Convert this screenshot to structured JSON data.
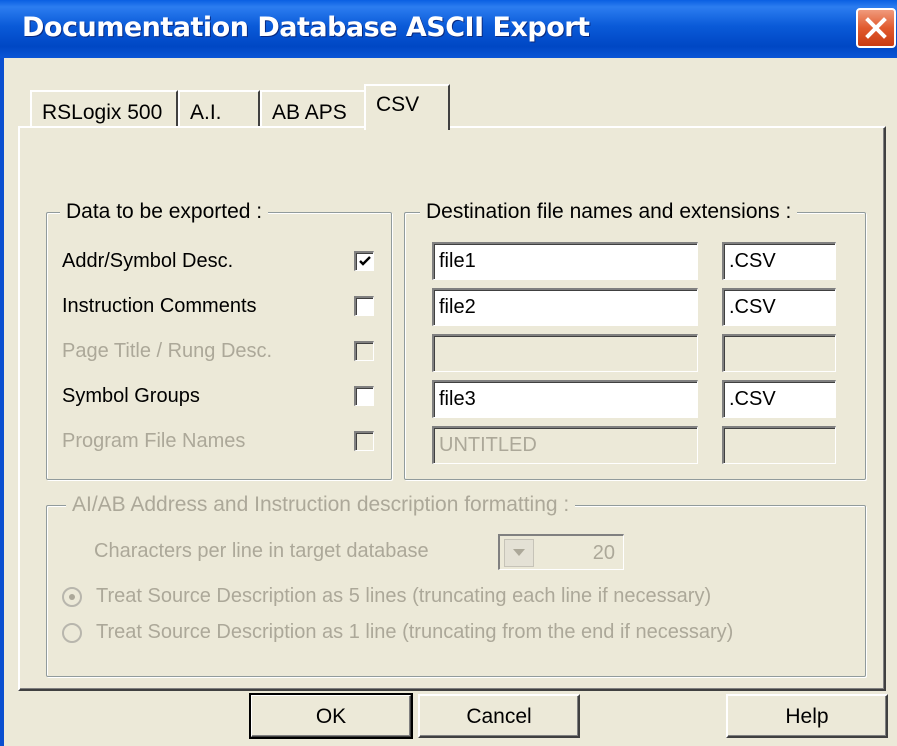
{
  "window": {
    "title": "Documentation Database ASCII Export",
    "accent_color": "#0a5fe2",
    "close_icon": "close-icon"
  },
  "tabs": [
    {
      "label": "RSLogix 500",
      "active": false
    },
    {
      "label": "A.I.",
      "active": false
    },
    {
      "label": "AB APS",
      "active": false
    },
    {
      "label": "CSV",
      "active": true
    }
  ],
  "data_group": {
    "legend": "Data to be exported :",
    "items": [
      {
        "label": "Addr/Symbol Desc.",
        "checked": true,
        "enabled": true
      },
      {
        "label": "Instruction Comments",
        "checked": false,
        "enabled": true
      },
      {
        "label": "Page Title / Rung Desc.",
        "checked": false,
        "enabled": false
      },
      {
        "label": "Symbol Groups",
        "checked": false,
        "enabled": true
      },
      {
        "label": "Program File Names",
        "checked": false,
        "enabled": false
      }
    ]
  },
  "dest_group": {
    "legend": "Destination file names and extensions :",
    "rows": [
      {
        "name": "file1",
        "ext": ".CSV",
        "enabled": true
      },
      {
        "name": "file2",
        "ext": ".CSV",
        "enabled": true
      },
      {
        "name": "",
        "ext": "",
        "enabled": false
      },
      {
        "name": "file3",
        "ext": ".CSV",
        "enabled": true
      },
      {
        "name": "UNTITLED",
        "ext": "",
        "enabled": false
      }
    ]
  },
  "format_group": {
    "legend": "AI/AB Address and Instruction description formatting :",
    "chars_label": "Characters per line in target database",
    "chars_value": "20",
    "radio_5_lines": "Treat Source Description as 5 lines (truncating each line if necessary)",
    "radio_1_line": "Treat Source Description as 1 line (truncating from the end if necessary)",
    "selected": "5_lines"
  },
  "buttons": {
    "ok": "OK",
    "cancel": "Cancel",
    "help": "Help"
  }
}
